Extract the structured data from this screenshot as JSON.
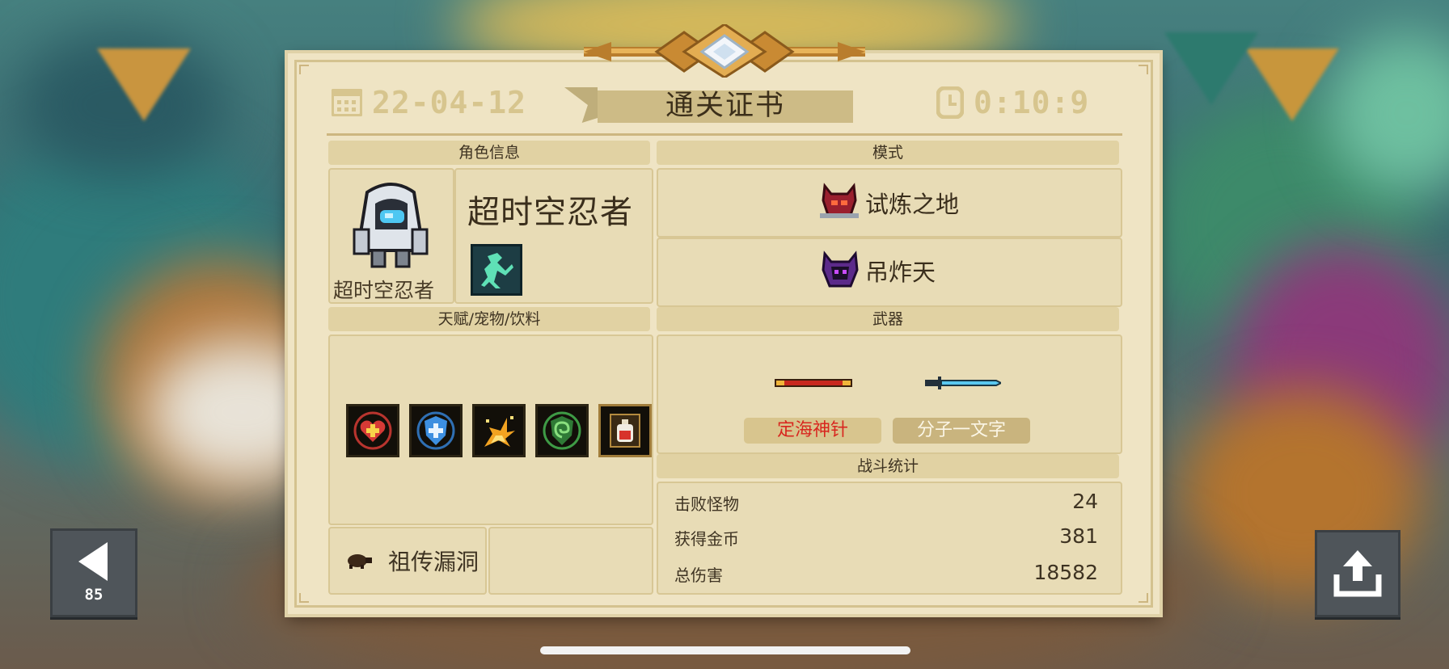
{
  "header": {
    "title": "通关证书",
    "date": "22-04-12",
    "time": "0:10:9"
  },
  "character": {
    "section_label": "角色信息",
    "name": "超时空忍者",
    "portrait_label": "超时空忍者"
  },
  "mode": {
    "section_label": "模式",
    "items": [
      "试炼之地",
      "吊炸天"
    ]
  },
  "talents": {
    "section_label": "天赋/宠物/饮料",
    "icons": [
      "heart-plus-icon",
      "shield-plus-icon",
      "explosion-icon",
      "green-swirl-icon",
      "potion-bottle-icon"
    ],
    "relic": "祖传漏洞"
  },
  "weapons": {
    "section_label": "武器",
    "items": [
      {
        "name": "定海神针",
        "color": "#d8261f"
      },
      {
        "name": "分子一文字",
        "color": "#fbf6e6"
      }
    ]
  },
  "stats": {
    "section_label": "战斗统计",
    "rows": [
      {
        "label": "击败怪物",
        "value": "24"
      },
      {
        "label": "获得金币",
        "value": "381"
      },
      {
        "label": "总伤害",
        "value": "18582"
      }
    ]
  },
  "buttons": {
    "back_count": "85"
  },
  "colors": {
    "paper": "#efe4c4",
    "header_bar": "#e1d2a3",
    "accent_gold": "#d7c58e"
  }
}
